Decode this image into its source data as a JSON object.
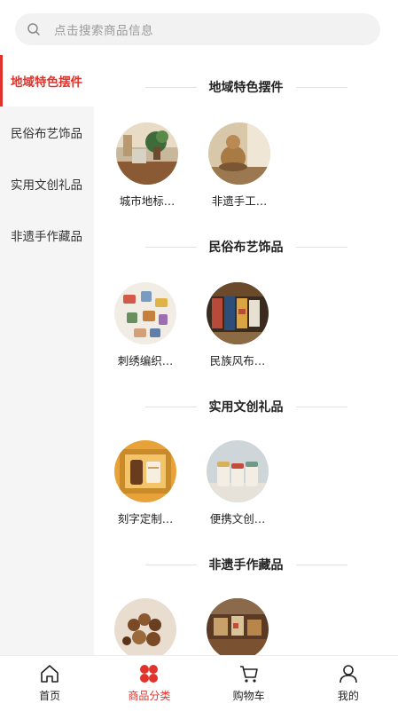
{
  "search": {
    "placeholder": "点击搜索商品信息",
    "icon": "search-icon"
  },
  "sidebar": {
    "active_index": 0,
    "active_color": "#e0332c",
    "items": [
      {
        "label": "地域特色摆件"
      },
      {
        "label": "民俗布艺饰品"
      },
      {
        "label": "实用文创礼品"
      },
      {
        "label": "非遗手作藏品"
      }
    ]
  },
  "sections": [
    {
      "title": "地域特色摆件",
      "products": [
        {
          "name": "城市地标…"
        },
        {
          "name": "非遗手工…"
        }
      ]
    },
    {
      "title": "民俗布艺饰品",
      "products": [
        {
          "name": "刺绣编织…"
        },
        {
          "name": "民族风布…"
        }
      ]
    },
    {
      "title": "实用文创礼品",
      "products": [
        {
          "name": "刻字定制…"
        },
        {
          "name": "便携文创…"
        }
      ]
    },
    {
      "title": "非遗手作藏品",
      "products": [
        {
          "name": ""
        },
        {
          "name": ""
        }
      ]
    }
  ],
  "tabbar": {
    "active_index": 1,
    "items": [
      {
        "label": "首页",
        "icon": "home-icon"
      },
      {
        "label": "商品分类",
        "icon": "category-icon"
      },
      {
        "label": "购物车",
        "icon": "cart-icon"
      },
      {
        "label": "我的",
        "icon": "user-icon"
      }
    ]
  }
}
